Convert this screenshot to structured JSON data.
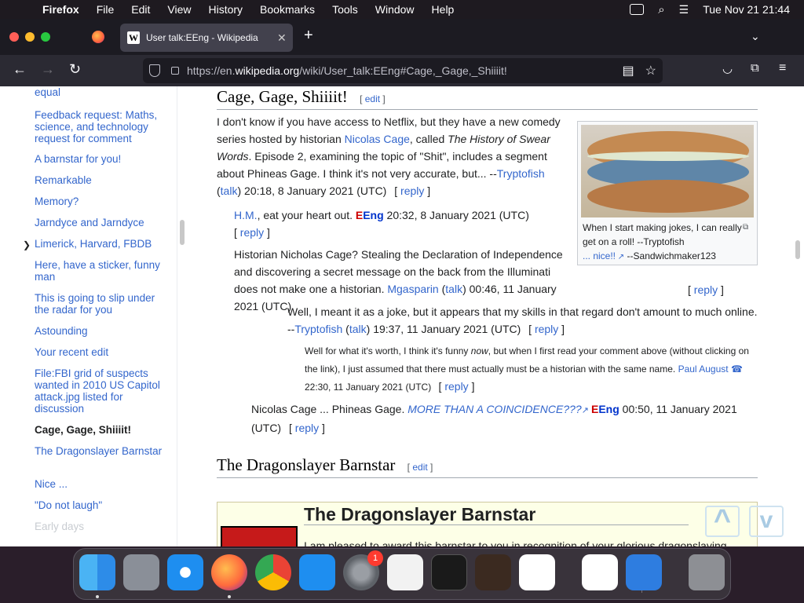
{
  "menubar": {
    "app": "Firefox",
    "items": [
      "File",
      "Edit",
      "View",
      "History",
      "Bookmarks",
      "Tools",
      "Window",
      "Help"
    ],
    "clock": "Tue Nov 21  21:44"
  },
  "browser": {
    "tab_title": "User talk:EEng - Wikipedia",
    "url_prefix": "https://en.",
    "url_domain": "wikipedia.org",
    "url_path": "/wiki/User_talk:EEng#Cage,_Gage,_Shiiiit!"
  },
  "toc": {
    "items": [
      "equal",
      "Feedback request: Maths, science, and technology request for comment",
      "A barnstar for you!",
      "Remarkable",
      "Memory?",
      "Jarndyce and Jarndyce",
      "Limerick, Harvard, FBDB",
      "Here, have a sticker, funny man",
      "This is going to slip under the radar for you",
      "Astounding",
      "Your recent edit",
      "File:FBI grid of suspects wanted in 2010 US Capitol attack.jpg listed for discussion",
      "Cage, Gage, Shiiiit!",
      "The Dragonslayer Barnstar",
      "Nice ...",
      "\"Do not laugh\"",
      "Early days"
    ]
  },
  "section1": {
    "title": "Cage, Gage, Shiiiit!",
    "edit": "edit",
    "p1_a": "I don't know if you have access to Netflix, but they have a new comedy series hosted by historian ",
    "p1_link": "Nicolas Cage",
    "p1_b": ", called ",
    "p1_italic": "The History of Swear Words",
    "p1_c": ". Episode 2, examining the topic of \"Shit\", includes a segment about Phineas Gage. I think it's not very accurate, but... --",
    "p1_user": "Tryptofish",
    "p1_talk": "talk",
    "p1_time": " 20:18, 8 January 2021 (UTC)",
    "reply": "reply",
    "p2_user": "H.M.",
    "p2_text": ", eat your heart out. ",
    "eeng_e": "E",
    "eeng_rest": "Eng",
    "p2_time": " 20:32, 8 January 2021 (UTC)",
    "p3_text": "Historian Nicholas Cage? Stealing the Declaration of Independence and discovering a secret message on the back from the Illuminati does not make one a historian. ",
    "p3_user": "Mgasparin",
    "p3_time": " 00:46, 11 January 2021 (UTC)",
    "p4_text": "Well, I meant it as a joke, but it appears that my skills in that regard don't amount to much online. --",
    "p4_time": " 19:37, 11 January 2021 (UTC)",
    "p5_a": "Well for what it's worth, I think it's funny ",
    "p5_italic": "now",
    "p5_b": ", but when I first read your comment above (without clicking on the link), I just assumed that there must actually must be a historian with the same name. ",
    "p5_user": "Paul August",
    "p5_phone": "☎",
    "p5_time": "22:30, 11 January 2021 (UTC)",
    "p6_a": "Nicolas Cage ... Phineas Gage. ",
    "p6_link": "MORE THAN A COINCIDENCE???",
    "p6_time": " 00:50, 11 January 2021 (UTC)",
    "thumb_caption": "When I start making jokes, I can really get on a roll! --Tryptofish",
    "thumb_link": "... nice!!",
    "thumb_sig": " --Sandwichmaker123"
  },
  "section2": {
    "title": "The Dragonslayer Barnstar",
    "edit": "edit",
    "box_title": "The Dragonslayer Barnstar",
    "box_text": "I am pleased to award this barnstar to you in recognition of your glorious dragonslaying efforts. Although I actually constructed this for you years ago, I"
  },
  "dock": {
    "badge": "1"
  }
}
